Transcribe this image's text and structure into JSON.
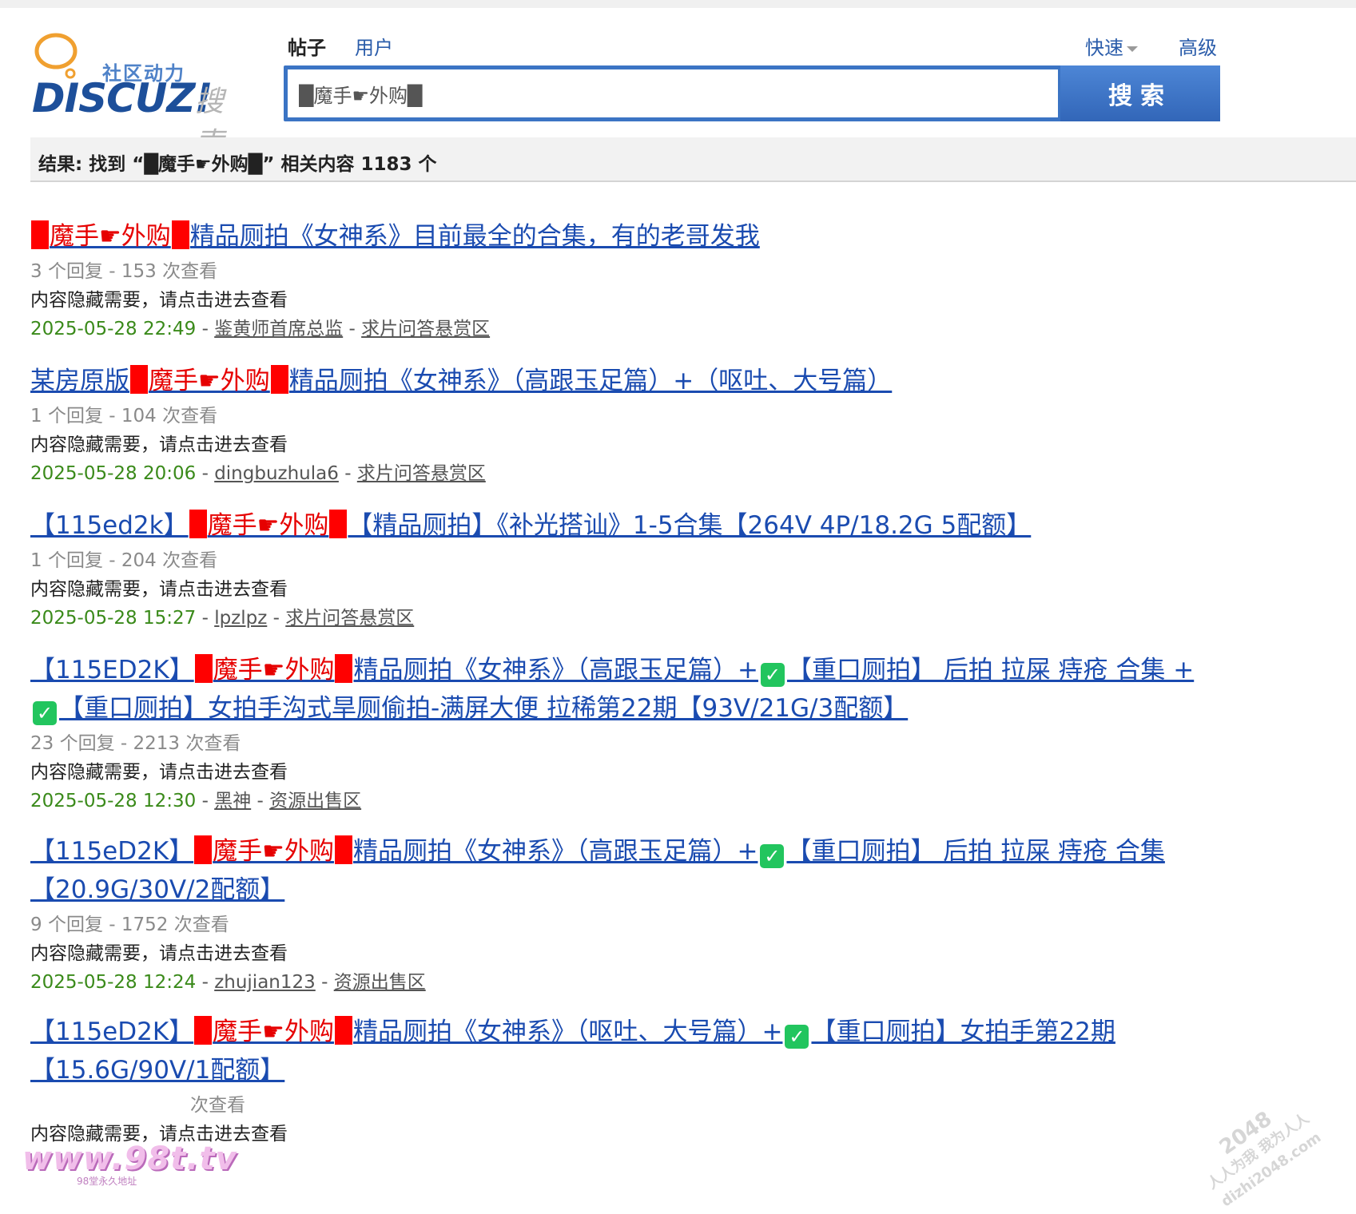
{
  "logo": {
    "tagline": "社区动力",
    "wordmark": "DISCUZ!",
    "search_word": "搜索"
  },
  "tabs": {
    "posts": "帖子",
    "users": "用户"
  },
  "header": {
    "quick": "快速",
    "advanced": "高级"
  },
  "search": {
    "value": "█魔手☛外购█",
    "button": "搜索"
  },
  "result_summary": "结果: 找到 “█魔手☛外购█” 相关内容 1183 个",
  "results": [
    {
      "title_prefix": "",
      "title_highlight": "魔手☛外购",
      "title_suffix": "精品厕拍《女神系》目前最全的合集，有的老哥发我",
      "stats": "3 个回复 - 153 次查看",
      "snippet": "内容隐藏需要，请点击进去查看",
      "date": "2025-05-28 22:49",
      "author": "鉴黄师首席总监",
      "forum": "求片问答悬赏区"
    },
    {
      "title_prefix": "某房原版",
      "title_highlight": "魔手☛外购",
      "title_suffix": "精品厕拍《女神系》（高跟玉足篇）+（呕吐、大号篇）",
      "stats": "1 个回复 - 104 次查看",
      "snippet": "内容隐藏需要，请点击进去查看",
      "date": "2025-05-28 20:06",
      "author": "dingbuzhula6",
      "forum": "求片问答悬赏区"
    },
    {
      "title_prefix": "【115ed2k】",
      "title_highlight": "魔手☛外购",
      "title_suffix": "【精品厕拍】《补光搭讪》1-5合集【264V 4P/18.2G 5配额】",
      "stats": "1 个回复 - 204 次查看",
      "snippet": "内容隐藏需要，请点击进去查看",
      "date": "2025-05-28 15:27",
      "author": "lpzlpz",
      "forum": "求片问答悬赏区"
    },
    {
      "title_prefix": "【115ED2K】",
      "title_highlight": "魔手☛外购",
      "title_part3": "精品厕拍《女神系》（高跟玉足篇）+",
      "title_part4": "【重口厕拍】 后拍 拉屎 痔疮 合集 +",
      "title_part5": "【重口厕拍】女拍手沟式旱厕偷拍-满屏大便 拉稀第22期【93V/21G/3配额】",
      "check_mark": "✓",
      "stats": "23 个回复 - 2213 次查看",
      "snippet": "内容隐藏需要，请点击进去查看",
      "date": "2025-05-28 12:30",
      "author": "黑神",
      "forum": "资源出售区"
    },
    {
      "title_prefix": "【115eD2K】",
      "title_highlight": "魔手☛外购",
      "title_part3": "精品厕拍《女神系》（高跟玉足篇）+",
      "title_part4": "【重口厕拍】 后拍 拉屎 痔疮 合集【20.9G/30V/2配额】",
      "check_mark": "✓",
      "stats": "9 个回复 - 1752 次查看",
      "snippet": "内容隐藏需要，请点击进去查看",
      "date": "2025-05-28 12:24",
      "author": "zhujian123",
      "forum": "资源出售区"
    },
    {
      "title_prefix": "【115eD2K】",
      "title_highlight": "魔手☛外购",
      "title_part3": "精品厕拍《女神系》（呕吐、大号篇）+",
      "title_part4": "【重口厕拍】女拍手第22期【15.6G/90V/1配额】",
      "check_mark": "✓",
      "stats": "次查看",
      "snippet": "内容隐藏需要，请点击进去查看"
    }
  ],
  "watermarks": {
    "left": "www.98t.tv",
    "left_sub": "98堂永久地址",
    "right_top": "2048",
    "right_mid": "人人为我 我为人人",
    "right_bottom": "dizhi2048.com"
  }
}
